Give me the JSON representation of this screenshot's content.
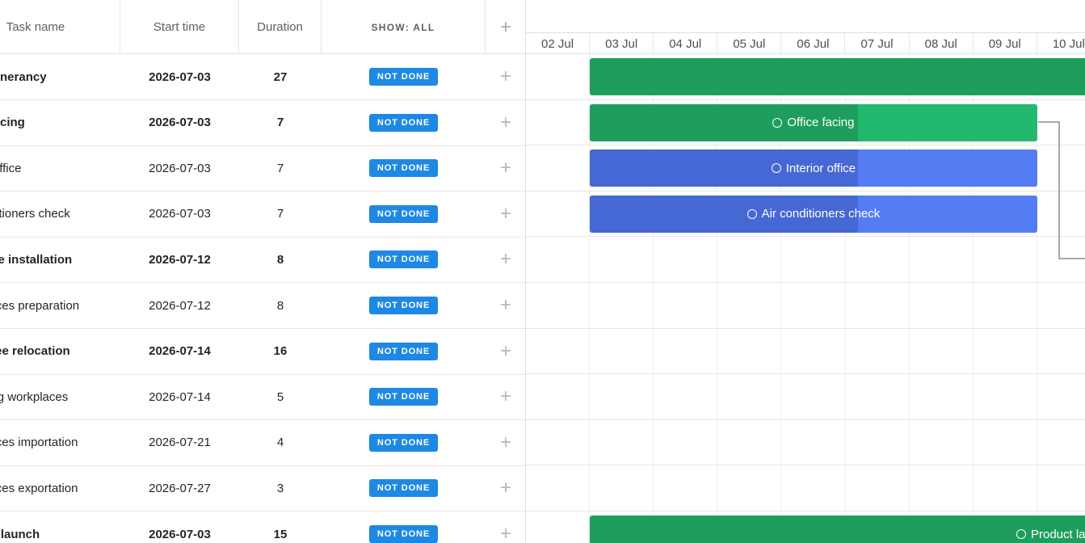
{
  "grid": {
    "columns": {
      "name": "Task name",
      "start": "Start time",
      "duration": "Duration",
      "status": "SHOW: ALL",
      "add": "+"
    },
    "rows": [
      {
        "name": "Office itinerancy",
        "start": "2026-07-03",
        "duration": "27",
        "status": "NOT DONE",
        "add": "+",
        "parent": true
      },
      {
        "name": "Office facing",
        "start": "2026-07-03",
        "duration": "7",
        "status": "NOT DONE",
        "add": "+",
        "parent": true
      },
      {
        "name": "Interior office",
        "start": "2026-07-03",
        "duration": "7",
        "status": "NOT DONE",
        "add": "+",
        "parent": false
      },
      {
        "name": "Air conditioners check",
        "start": "2026-07-03",
        "duration": "7",
        "status": "NOT DONE",
        "add": "+",
        "parent": false
      },
      {
        "name": "Furniture installation",
        "start": "2026-07-12",
        "duration": "8",
        "status": "NOT DONE",
        "add": "+",
        "parent": true
      },
      {
        "name": "Workplaces preparation",
        "start": "2026-07-12",
        "duration": "8",
        "status": "NOT DONE",
        "add": "+",
        "parent": false
      },
      {
        "name": "Employee relocation",
        "start": "2026-07-14",
        "duration": "16",
        "status": "NOT DONE",
        "add": "+",
        "parent": true
      },
      {
        "name": "Preparing workplaces",
        "start": "2026-07-14",
        "duration": "5",
        "status": "NOT DONE",
        "add": "+",
        "parent": false
      },
      {
        "name": "Workplaces importation",
        "start": "2026-07-21",
        "duration": "4",
        "status": "NOT DONE",
        "add": "+",
        "parent": false
      },
      {
        "name": "Workplaces exportation",
        "start": "2026-07-27",
        "duration": "3",
        "status": "NOT DONE",
        "add": "+",
        "parent": false
      },
      {
        "name": "Product launch",
        "start": "2026-07-03",
        "duration": "15",
        "status": "NOT DONE",
        "add": "+",
        "parent": true
      }
    ]
  },
  "timeline": {
    "days": [
      "02 Jul",
      "03 Jul",
      "04 Jul",
      "05 Jul",
      "06 Jul",
      "07 Jul",
      "08 Jul",
      "09 Jul",
      "10 Jul"
    ],
    "first_day": "2026-07-02"
  },
  "bars": [
    {
      "row": 0,
      "start_day": 1,
      "days": 27,
      "progress": 0,
      "label": "",
      "color": "#1e9e5d",
      "progress_color": "#1e9e5d"
    },
    {
      "row": 1,
      "start_day": 1,
      "days": 7,
      "progress": 0.6,
      "label": "Office facing",
      "color": "#22b86e",
      "progress_color": "#1e9e5d"
    },
    {
      "row": 2,
      "start_day": 1,
      "days": 7,
      "progress": 0.6,
      "label": "Interior office",
      "color": "#547df4",
      "progress_color": "#4668d4"
    },
    {
      "row": 3,
      "start_day": 1,
      "days": 7,
      "progress": 0.6,
      "label": "Air conditioners check",
      "color": "#547df4",
      "progress_color": "#4668d4"
    },
    {
      "row": 10,
      "start_day": 1,
      "days": 15,
      "progress": 0,
      "label": "Product launch",
      "color": "#1e9e5d",
      "progress_color": "#1e9e5d"
    }
  ],
  "colors": {
    "badge": "#1e88e5",
    "parent_bar": "#1e9e5d",
    "child_bar": "#547df4",
    "link": "#8a8f96"
  }
}
